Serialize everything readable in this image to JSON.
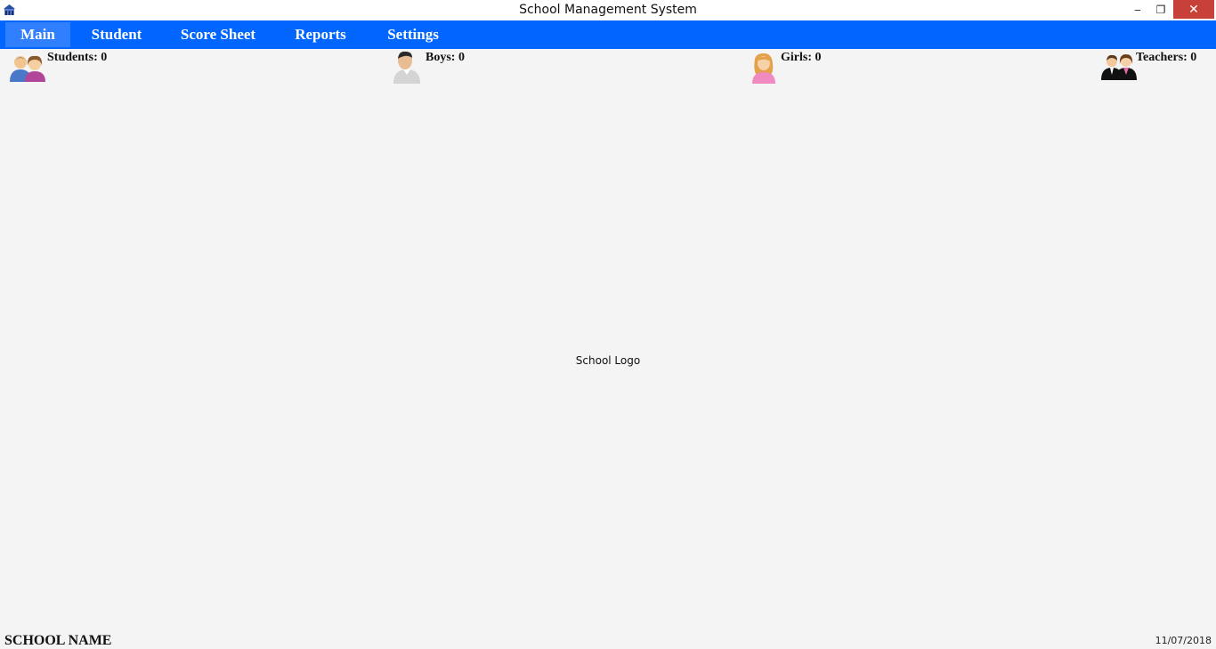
{
  "window": {
    "title": "School Management System",
    "icons": {
      "app": "school-building-icon",
      "minimize": "minimize-icon",
      "maximize": "restore-icon",
      "close": "close-icon"
    },
    "glyphs": {
      "minimize": "‒",
      "maximize": "❐",
      "close": "✕"
    },
    "close_color": "#c7403a"
  },
  "menu": {
    "accent": "#0066ff",
    "items": [
      {
        "label": "Main",
        "active": true
      },
      {
        "label": "Student"
      },
      {
        "label": "Score Sheet"
      },
      {
        "label": "Reports"
      },
      {
        "label": "Settings"
      }
    ]
  },
  "stats": {
    "students": {
      "label": "Students: 0",
      "icon": "students-group-icon"
    },
    "boys": {
      "label": "Boys: 0",
      "icon": "boy-avatar-icon"
    },
    "girls": {
      "label": "Girls: 0",
      "icon": "girl-avatar-icon"
    },
    "teachers": {
      "label": "Teachers: 0",
      "icon": "teachers-pair-icon"
    }
  },
  "logo": {
    "text": "School Logo"
  },
  "footer": {
    "school_name": "SCHOOL NAME",
    "date": "11/07/2018"
  }
}
